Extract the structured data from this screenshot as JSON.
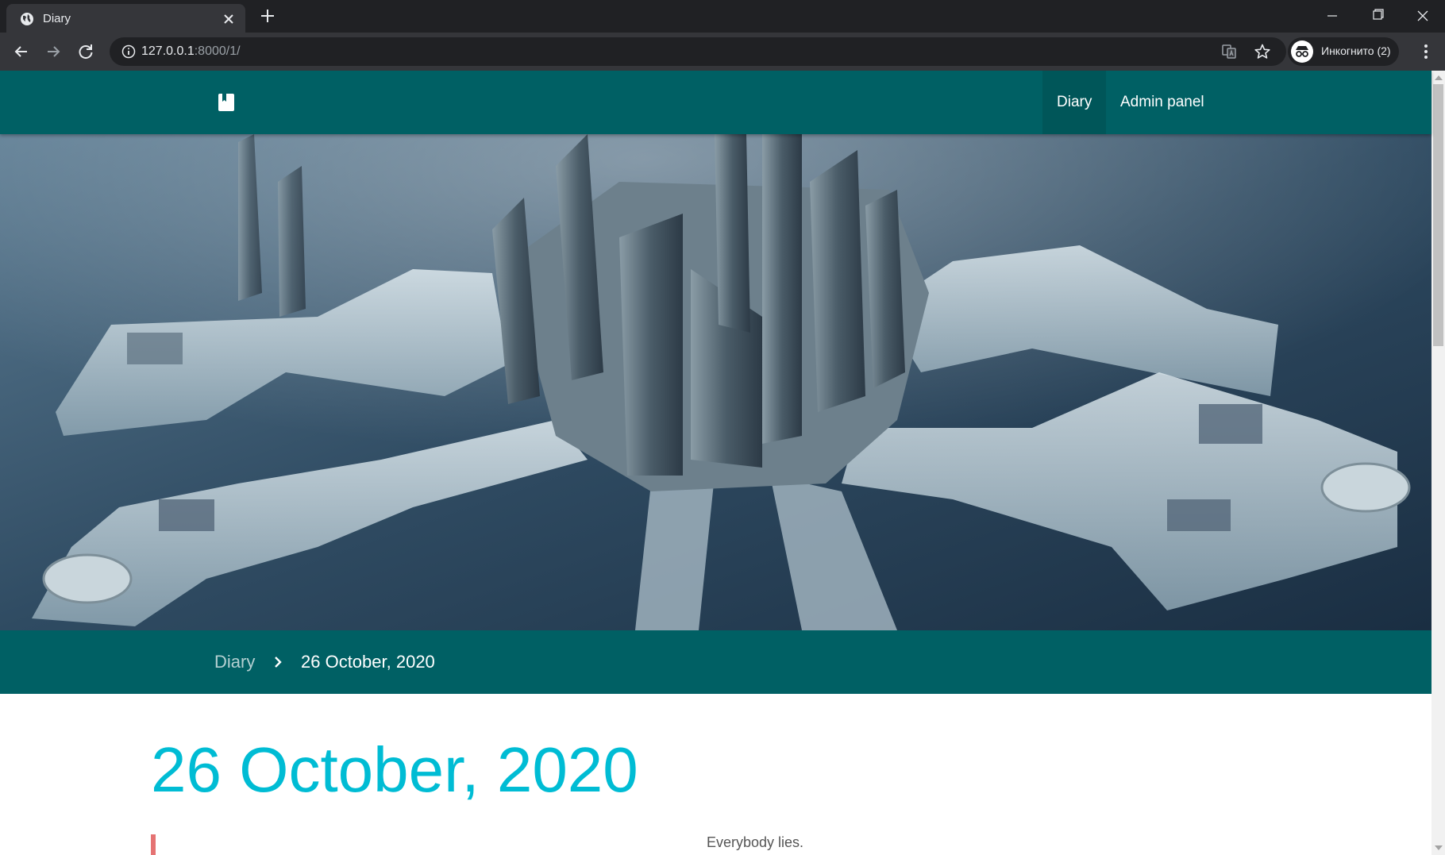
{
  "browser": {
    "tab_title": "Diary",
    "url_host": "127.0.0.1",
    "url_rest": ":8000/1/",
    "incognito_label": "Инкогнито (2)",
    "icons": [
      "globe-icon",
      "close-icon",
      "plus-icon",
      "minimize-icon",
      "maximize-icon",
      "close-window-icon",
      "back-arrow-icon",
      "forward-arrow-icon",
      "reload-icon",
      "info-icon",
      "translate-icon",
      "star-icon",
      "incognito-icon",
      "more-vert-icon"
    ]
  },
  "header": {
    "brand_icon": "book-icon",
    "nav": [
      {
        "label": "Diary",
        "active": true
      },
      {
        "label": "Admin panel",
        "active": false
      }
    ]
  },
  "breadcrumb": {
    "parent": "Diary",
    "separator_icon": "chevron-right-icon",
    "current": "26 October, 2020"
  },
  "post": {
    "title": "26 October, 2020",
    "body": "Everybody lies."
  },
  "colors": {
    "primary": "#006064",
    "title_accent": "#00bcd4",
    "quote_accent": "#e57373",
    "chrome_dark": "#202124",
    "chrome_mid": "#35363a"
  }
}
